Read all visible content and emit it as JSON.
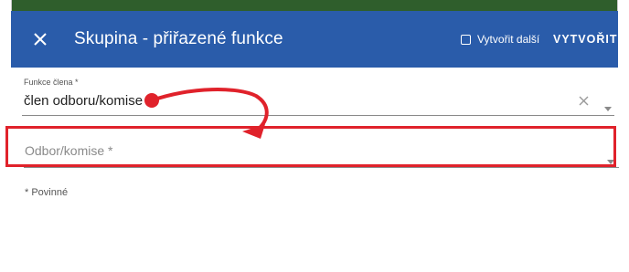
{
  "dialog": {
    "title": "Skupina - přiřazené funkce",
    "create_next_label": "Vytvořit další",
    "create_button_label": "VYTVOŘIT",
    "accent_color": "#2a5caa"
  },
  "form": {
    "member_function": {
      "label": "Funkce člena *",
      "value": "člen odboru/komise"
    },
    "department": {
      "placeholder": "Odbor/komise *"
    },
    "required_note": "* Povinné"
  },
  "annotation": {
    "color": "#e0222b"
  }
}
